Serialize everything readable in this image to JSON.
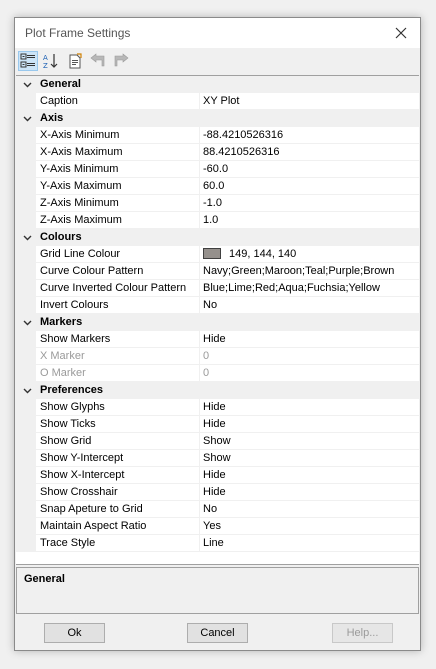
{
  "window": {
    "title": "Plot Frame Settings"
  },
  "toolbar": {
    "buttons": [
      {
        "name": "categorized",
        "active": true
      },
      {
        "name": "alphabetical",
        "active": false
      },
      {
        "name": "property-pages",
        "active": false
      },
      {
        "name": "undo",
        "active": false
      },
      {
        "name": "redo",
        "active": false
      }
    ]
  },
  "grid": {
    "categories": [
      {
        "label": "General",
        "props": [
          {
            "name": "Caption",
            "value": "XY Plot"
          }
        ]
      },
      {
        "label": "Axis",
        "props": [
          {
            "name": "X-Axis Minimum",
            "value": "-88.4210526316"
          },
          {
            "name": "X-Axis Maximum",
            "value": "88.4210526316"
          },
          {
            "name": "Y-Axis Minimum",
            "value": "-60.0"
          },
          {
            "name": "Y-Axis Maximum",
            "value": "60.0"
          },
          {
            "name": "Z-Axis Minimum",
            "value": "-1.0"
          },
          {
            "name": "Z-Axis Maximum",
            "value": "1.0"
          }
        ]
      },
      {
        "label": "Colours",
        "props": [
          {
            "name": "Grid Line Colour",
            "value": "149, 144, 140",
            "swatch": "#95908c"
          },
          {
            "name": "Curve Colour Pattern",
            "value": "Navy;Green;Maroon;Teal;Purple;Brown"
          },
          {
            "name": "Curve Inverted Colour Pattern",
            "value": "Blue;Lime;Red;Aqua;Fuchsia;Yellow"
          },
          {
            "name": "Invert Colours",
            "value": "No"
          }
        ]
      },
      {
        "label": "Markers",
        "props": [
          {
            "name": "Show Markers",
            "value": "Hide"
          },
          {
            "name": "X Marker",
            "value": "0",
            "disabled": true
          },
          {
            "name": "O Marker",
            "value": "0",
            "disabled": true
          }
        ]
      },
      {
        "label": "Preferences",
        "props": [
          {
            "name": "Show Glyphs",
            "value": "Hide"
          },
          {
            "name": "Show Ticks",
            "value": "Hide"
          },
          {
            "name": "Show Grid",
            "value": "Show"
          },
          {
            "name": "Show Y-Intercept",
            "value": "Show"
          },
          {
            "name": "Show X-Intercept",
            "value": "Hide"
          },
          {
            "name": "Show Crosshair",
            "value": "Hide"
          },
          {
            "name": "Snap Apeture to Grid",
            "value": "No"
          },
          {
            "name": "Maintain Aspect Ratio",
            "value": "Yes"
          },
          {
            "name": "Trace Style",
            "value": "Line"
          }
        ]
      }
    ]
  },
  "description": {
    "title": "General"
  },
  "buttons": {
    "ok": "Ok",
    "cancel": "Cancel",
    "help": "Help..."
  }
}
